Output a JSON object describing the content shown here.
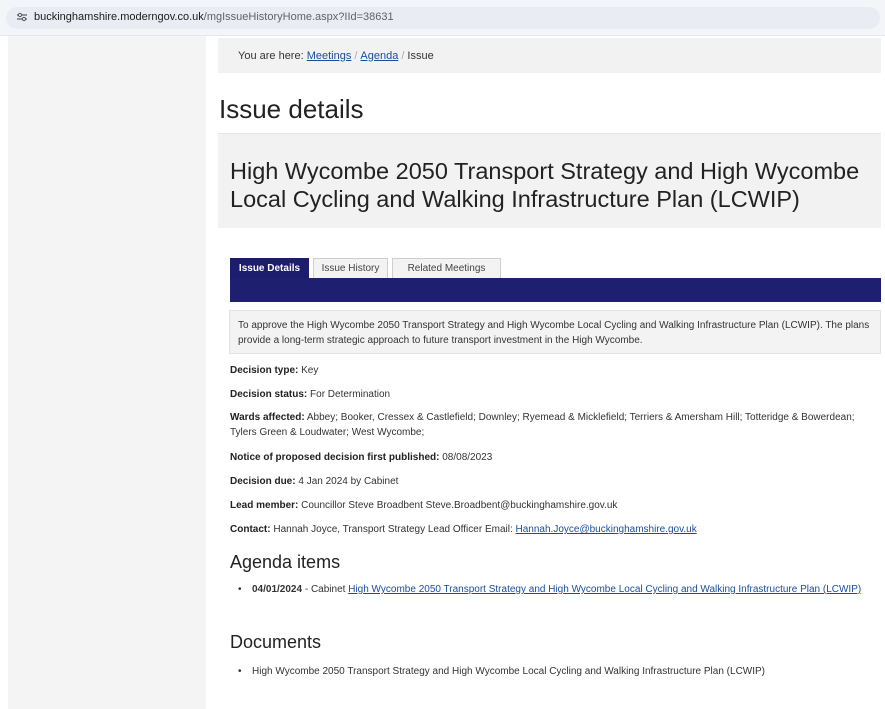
{
  "browser": {
    "url_host": "buckinghamshire.moderngov.co.uk",
    "url_path": "/mgIssueHistoryHome.aspx?IId=38631"
  },
  "breadcrumb": {
    "prefix": "You are here:",
    "items": [
      "Meetings",
      "Agenda",
      "Issue"
    ]
  },
  "page_title": "Issue details",
  "issue_title": "High Wycombe 2050 Transport Strategy and High Wycombe Local Cycling and Walking Infrastructure Plan (LCWIP)",
  "tabs": [
    {
      "label": "Issue Details",
      "active": true
    },
    {
      "label": "Issue History",
      "active": false
    },
    {
      "label": "Related Meetings",
      "active": false
    }
  ],
  "purpose": "To approve the High Wycombe 2050 Transport Strategy and High Wycombe Local Cycling and Walking Infrastructure Plan (LCWIP). The plans provide a long-term strategic approach to future transport investment in the High Wycombe.",
  "fields": {
    "decision_type": {
      "label": "Decision type:",
      "value": "Key"
    },
    "decision_status": {
      "label": "Decision status:",
      "value": "For Determination"
    },
    "wards": {
      "label": "Wards affected:",
      "value": "Abbey; Booker, Cressex & Castlefield; Downley; Ryemead & Micklefield; Terriers & Amersham Hill; Totteridge & Bowerdean; Tylers Green & Loudwater; West Wycombe;"
    },
    "notice": {
      "label": "Notice of proposed decision first published:",
      "value": "08/08/2023"
    },
    "decision_due": {
      "label": "Decision due:",
      "value": "4 Jan 2024 by Cabinet"
    },
    "lead_member": {
      "label": "Lead member:",
      "value": "Councillor Steve Broadbent Steve.Broadbent@buckinghamshire.gov.uk"
    },
    "contact": {
      "label": "Contact:",
      "value": "Hannah Joyce, Transport Strategy Lead Officer Email:",
      "email": "Hannah.Joyce@buckinghamshire.gov.uk"
    }
  },
  "agenda": {
    "heading": "Agenda items",
    "items": [
      {
        "date": "04/01/2024",
        "meeting": "- Cabinet",
        "link": "High Wycombe 2050 Transport Strategy and High Wycombe Local Cycling and Walking Infrastructure Plan (LCWIP)"
      }
    ]
  },
  "documents": {
    "heading": "Documents",
    "items": [
      "High Wycombe 2050 Transport Strategy and High Wycombe Local Cycling and Walking Infrastructure Plan (LCWIP)"
    ]
  }
}
